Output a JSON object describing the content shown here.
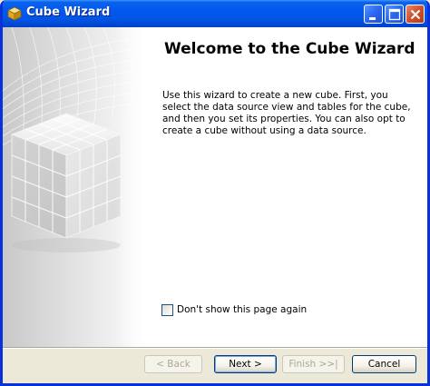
{
  "window": {
    "title": "Cube Wizard",
    "minimize_label": "_",
    "maximize_label": "□",
    "close_label": "X"
  },
  "page": {
    "heading": "Welcome to the Cube Wizard",
    "description": "Use this wizard to create a new cube. First, you select the data source view and tables for the cube, and then you set its properties. You can also opt to create a cube without using a data source."
  },
  "options": {
    "dont_show_label": "Don't show this page again",
    "dont_show_checked": false
  },
  "buttons": {
    "back_label": "< Back",
    "next_label": "Next >",
    "finish_label": "Finish >>|",
    "cancel_label": "Cancel"
  },
  "colors": {
    "titlebar": "#0058EE",
    "window_frame": "#0831D9",
    "dialog_bg": "#ECE9D8",
    "content_bg": "#FFFFFF"
  },
  "icons": {
    "title": "cube-icon",
    "side": "cube-grid-illustration"
  }
}
